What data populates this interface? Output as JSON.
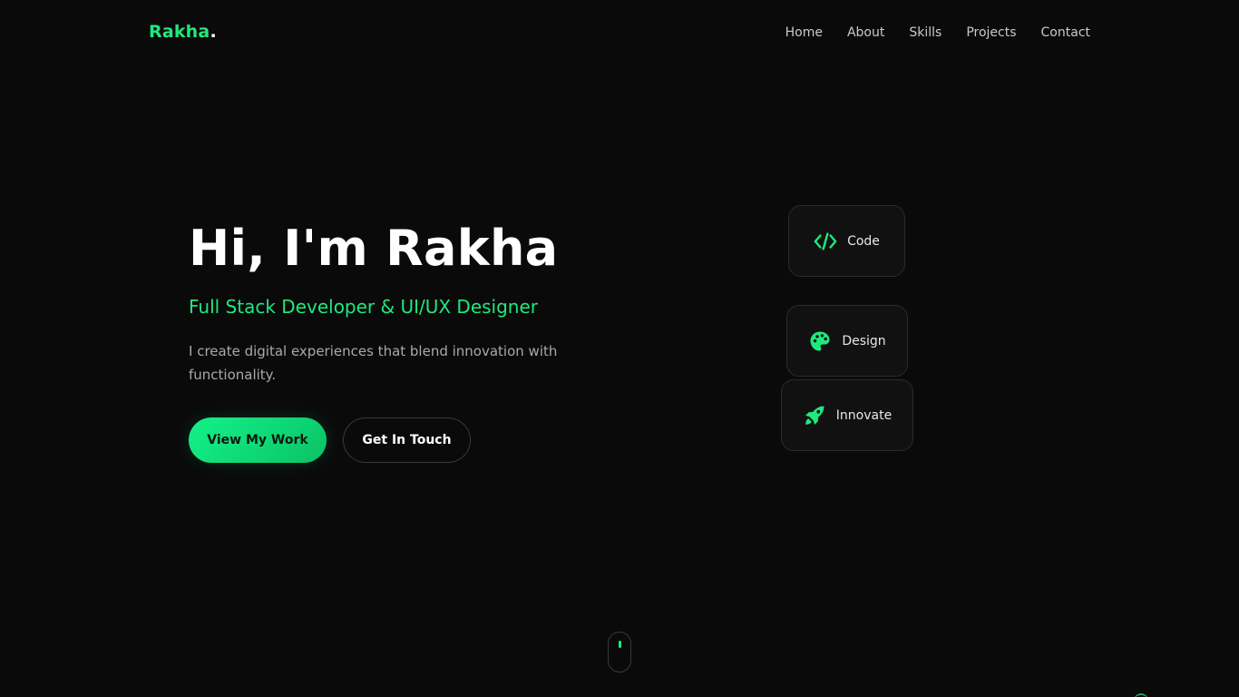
{
  "header": {
    "logo_text": "Rakha",
    "logo_dot": ".",
    "nav": [
      "Home",
      "About",
      "Skills",
      "Projects",
      "Contact"
    ]
  },
  "hero": {
    "title": "Hi, I'm Rakha",
    "subtitle": "Full Stack Developer & UI/UX Designer",
    "description": "I create digital experiences that blend innovation with functionality.",
    "primary_button": "View My Work",
    "secondary_button": "Get In Touch"
  },
  "cards": [
    {
      "label": "Code",
      "icon": "code-icon"
    },
    {
      "label": "Design",
      "icon": "palette-icon"
    },
    {
      "label": "Innovate",
      "icon": "rocket-icon"
    }
  ],
  "colors": {
    "background": "#0a0a0a",
    "accent": "#1de97e",
    "card_background": "#111111",
    "card_border": "#2c2c2c",
    "muted_text": "#a9a9a9"
  }
}
